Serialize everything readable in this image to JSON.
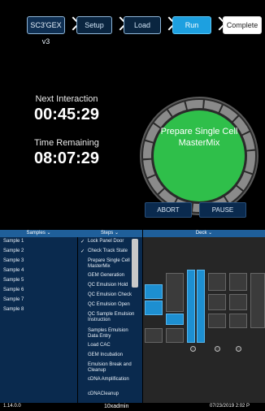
{
  "workflow": {
    "steps": [
      "SC3'GEX v3",
      "Setup",
      "Load",
      "Run",
      "Complete"
    ]
  },
  "timers": {
    "next_label": "Next Interaction",
    "next_value": "00:45:29",
    "remaining_label": "Time Remaining",
    "remaining_value": "08:07:29"
  },
  "current_action": "Prepare Single Cell MasterMix",
  "buttons": {
    "abort": "ABORT",
    "pause": "PAUSE"
  },
  "panels": {
    "samples_header": "Samples ⌄",
    "steps_header": "Steps ⌄",
    "deck_header": "Deck ⌄"
  },
  "samples": [
    "Sample 1",
    "Sample 2",
    "Sample 3",
    "Sample 4",
    "Sample 5",
    "Sample 6",
    "Sample 7",
    "Sample 8"
  ],
  "steps": [
    {
      "label": "Lock Panel Door",
      "checked": true
    },
    {
      "label": "Check Track State",
      "checked": true
    },
    {
      "label": "Prepare Single Cell MasterMix",
      "checked": false
    },
    {
      "label": "GEM Generation",
      "checked": false
    },
    {
      "label": "QC Emulsion Hold",
      "checked": false
    },
    {
      "label": "QC Emulsion Check",
      "checked": false
    },
    {
      "label": "QC Emulsion Open",
      "checked": false
    },
    {
      "label": "QC Sample Emulsion Instruction",
      "checked": false
    },
    {
      "label": "Samples Emulsion Data Entry",
      "checked": false
    },
    {
      "label": "Load CAC",
      "checked": false
    },
    {
      "label": "GEM Incubation",
      "checked": false
    },
    {
      "label": "Emulsion Break and Cleanup",
      "checked": false
    },
    {
      "label": "cDNA Amplification",
      "checked": false
    },
    {
      "label": "cDNACleanup",
      "checked": false
    }
  ],
  "status": {
    "version": "1.14.0.0",
    "user": "10xadmin",
    "datetime": "07/23/2019 2:02 P"
  },
  "colors": {
    "current_step": "#1da0e0",
    "ring_green": "#2fbf4a",
    "panel_bg": "#0a2a4e"
  }
}
